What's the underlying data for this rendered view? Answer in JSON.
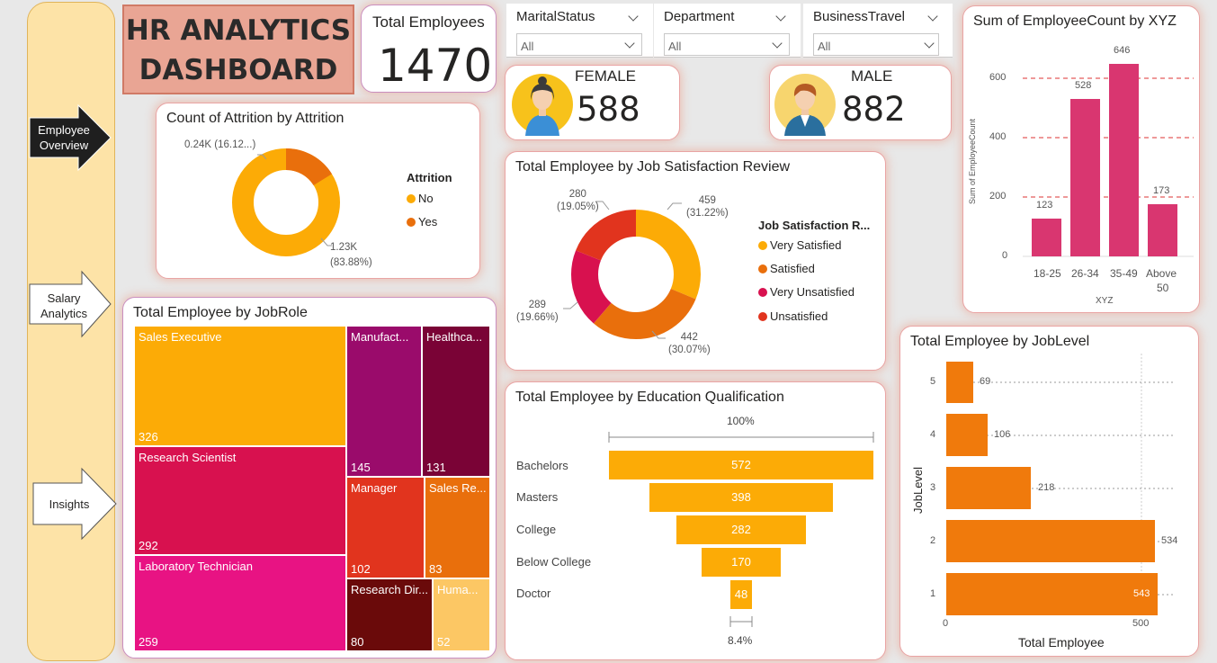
{
  "nav": {
    "employee_overview": "Employee Overview",
    "salary_analytics": "Salary Analytics",
    "insights": "Insights"
  },
  "title": {
    "line1": "HR ANALYTICS",
    "line2": "DASHBOARD"
  },
  "kpi": {
    "total_label": "Total Employees",
    "total_value": "1470",
    "female_label": "FEMALE",
    "female_value": "588",
    "male_label": "MALE",
    "male_value": "882"
  },
  "slicers": [
    {
      "label": "MaritalStatus",
      "value": "All"
    },
    {
      "label": "Department",
      "value": "All"
    },
    {
      "label": "BusinessTravel",
      "value": "All"
    }
  ],
  "attrition": {
    "title": "Count of Attrition by Attrition",
    "legend_title": "Attrition",
    "legend": [
      "No",
      "Yes"
    ],
    "label_yes": "0.24K (16.12...)",
    "label_no_1": "1.23K",
    "label_no_2": "(83.88%)"
  },
  "satisfaction": {
    "title": "Total Employee by Job Satisfaction Review",
    "legend_title": "Job Satisfaction R...",
    "legend": [
      "Very Satisfied",
      "Satisfied",
      "Very Unsatisfied",
      "Unsatisfied"
    ],
    "labels": [
      {
        "v": "459",
        "p": "(31.22%)"
      },
      {
        "v": "442",
        "p": "(30.07%)"
      },
      {
        "v": "289",
        "p": "(19.66%)"
      },
      {
        "v": "280",
        "p": "(19.05%)"
      }
    ]
  },
  "xyz": {
    "title": "Sum of EmployeeCount by XYZ",
    "ylabel": "Sum of EmployeeCount",
    "xlabel": "XYZ",
    "yticks": [
      "600",
      "400",
      "200",
      "0"
    ],
    "cats": [
      "18-25",
      "26-34",
      "35-49",
      "Above"
    ],
    "cat4_line2": "50",
    "vals": [
      "123",
      "528",
      "646",
      "173"
    ]
  },
  "jobrole": {
    "title": "Total Employee by JobRole",
    "items": [
      {
        "n": "Sales Executive",
        "v": "326"
      },
      {
        "n": "Research Scientist",
        "v": "292"
      },
      {
        "n": "Laboratory Technician",
        "v": "259"
      },
      {
        "n": "Manufact...",
        "v": "145"
      },
      {
        "n": "Healthca...",
        "v": "131"
      },
      {
        "n": "Manager",
        "v": "102"
      },
      {
        "n": "Sales Re...",
        "v": "83"
      },
      {
        "n": "Research Dir...",
        "v": "80"
      },
      {
        "n": "Huma...",
        "v": "52"
      }
    ]
  },
  "education": {
    "title": "Total Employee by Education Qualification",
    "top": "100%",
    "bottom": "8.4%",
    "cats": [
      "Bachelors",
      "Masters",
      "College",
      "Below College",
      "Doctor"
    ],
    "vals": [
      "572",
      "398",
      "282",
      "170",
      "48"
    ]
  },
  "joblevel": {
    "title": "Total Employee by JobLevel",
    "ylabel": "JobLevel",
    "xlabel": "Total Employee",
    "xticks": [
      "0",
      "500"
    ],
    "levels": [
      "5",
      "4",
      "3",
      "2",
      "1"
    ],
    "vals": [
      "69",
      "106",
      "218",
      "534",
      "543"
    ]
  },
  "chart_data": [
    {
      "type": "pie",
      "title": "Count of Attrition by Attrition",
      "categories": [
        "No",
        "Yes"
      ],
      "values": [
        1233,
        237
      ],
      "percent": [
        83.88,
        16.12
      ]
    },
    {
      "type": "pie",
      "title": "Total Employee by Job Satisfaction Review",
      "categories": [
        "Very Satisfied",
        "Satisfied",
        "Very Unsatisfied",
        "Unsatisfied"
      ],
      "values": [
        459,
        442,
        289,
        280
      ],
      "percent": [
        31.22,
        30.07,
        19.66,
        19.05
      ]
    },
    {
      "type": "bar",
      "title": "Sum of EmployeeCount by XYZ",
      "categories": [
        "18-25",
        "26-34",
        "35-49",
        "Above 50"
      ],
      "values": [
        123,
        528,
        646,
        173
      ],
      "xlabel": "XYZ",
      "ylabel": "Sum of EmployeeCount",
      "ylim": [
        0,
        700
      ]
    },
    {
      "type": "bar",
      "title": "Total Employee by JobRole",
      "categories": [
        "Sales Executive",
        "Research Scientist",
        "Laboratory Technician",
        "Manufact...",
        "Healthca...",
        "Manager",
        "Sales Re...",
        "Research Dir...",
        "Huma..."
      ],
      "values": [
        326,
        292,
        259,
        145,
        131,
        102,
        83,
        80,
        52
      ]
    },
    {
      "type": "bar",
      "title": "Total Employee by Education Qualification",
      "categories": [
        "Bachelors",
        "Masters",
        "College",
        "Below College",
        "Doctor"
      ],
      "values": [
        572,
        398,
        282,
        170,
        48
      ]
    },
    {
      "type": "bar",
      "title": "Total Employee by JobLevel",
      "categories": [
        "5",
        "4",
        "3",
        "2",
        "1"
      ],
      "values": [
        69,
        106,
        218,
        534,
        543
      ],
      "xlabel": "Total Employee",
      "ylabel": "JobLevel"
    }
  ],
  "colors": {
    "amber": "#fcab06",
    "orange": "#e96f0c",
    "crimson": "#d8114f",
    "red": "#e1341e",
    "pink": "#d93670"
  }
}
